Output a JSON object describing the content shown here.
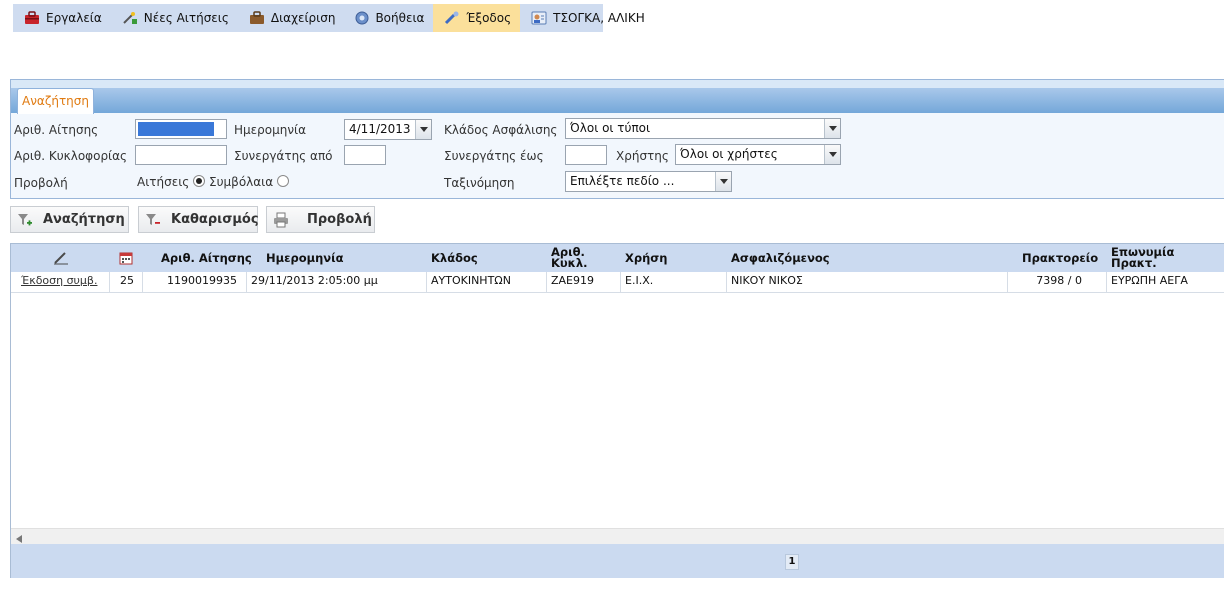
{
  "menu": [
    {
      "label": "Εργαλεία",
      "icon": "toolbox-icon"
    },
    {
      "label": "Νέες Αιτήσεις",
      "icon": "magic-wand-icon"
    },
    {
      "label": "Διαχείριση",
      "icon": "briefcase-icon"
    },
    {
      "label": "Βοήθεια",
      "icon": "help-icon"
    },
    {
      "label": "Έξοδος",
      "icon": "exit-icon"
    },
    {
      "label": "ΤΣΟΓΚΑ, ΑΛΙΚΗ",
      "icon": "user-card-icon"
    }
  ],
  "search": {
    "tab_label": "Αναζήτηση",
    "application_no_label": "Αριθ. Αίτησης",
    "application_no_value": "",
    "plate_label": "Αριθ. Κυκλοφορίας",
    "plate_value": "",
    "view_label": "Προβολή",
    "view_options": [
      "Αιτήσεις",
      "Συμβόλαια"
    ],
    "date_label": "Ημερομηνία",
    "date_value": "4/11/2013",
    "partner_from_label": "Συνεργάτης από",
    "partner_from_value": "",
    "branch_label": "Κλάδος Ασφάλισης",
    "branch_value": "Όλοι οι τύποι",
    "partner_to_label": "Συνεργάτης έως",
    "partner_to_value": "",
    "user_label": "Χρήστης",
    "user_value": "Όλοι οι χρήστες",
    "sort_label": "Ταξινόμηση",
    "sort_value": "Επιλέξτε πεδίο ..."
  },
  "buttons": {
    "search": "Αναζήτηση",
    "clear": "Καθαρισμός",
    "view": "Προβολή"
  },
  "grid": {
    "headers": {
      "app_no": "Αριθ. Αίτησης",
      "date": "Ημερομηνία",
      "branch": "Κλάδος",
      "plate_line1": "Αριθ.",
      "plate_line2": "Κυκλ.",
      "use": "Χρήση",
      "insured": "Ασφαλιζόμενος",
      "agency": "Πρακτορείο",
      "agency_name": "Επωνυμία Πρακτ."
    },
    "rows": [
      {
        "action": "Έκδοση συμβ.",
        "count": "25",
        "app_no": "1190019935",
        "date": "29/11/2013 2:05:00 μμ",
        "branch": "ΑΥΤΟΚΙΝΗΤΩΝ",
        "plate": "ΖΑΕ919",
        "use": "Ε.Ι.Χ.",
        "insured": "ΝΙΚΟΥ ΝΙΚΟΣ",
        "agency": "7398 / 0",
        "agency_name": "ΕΥΡΩΠΗ ΑΕΓΑ"
      }
    ],
    "page": "1"
  }
}
